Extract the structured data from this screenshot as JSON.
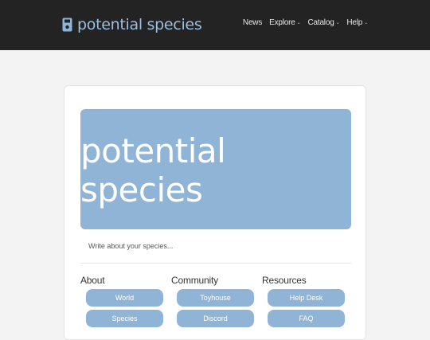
{
  "navbar": {
    "brand_icon": "save-disk-icon",
    "brand": "potential species",
    "links": [
      {
        "label": "News",
        "dropdown": false
      },
      {
        "label": "Explore",
        "dropdown": true
      },
      {
        "label": "Catalog",
        "dropdown": true
      },
      {
        "label": "Help",
        "dropdown": true
      }
    ],
    "caret": "⌄"
  },
  "card": {
    "banner_text": "potential species",
    "description": "Write about your species...",
    "columns": [
      {
        "heading": "About",
        "links": [
          "World",
          "Species"
        ]
      },
      {
        "heading": "Community",
        "links": [
          "Toyhouse",
          "Discord"
        ]
      },
      {
        "heading": "Resources",
        "links": [
          "Help Desk",
          "FAQ"
        ]
      }
    ]
  },
  "colors": {
    "navbar_bg": "#232323",
    "accent": "#8fb4d6",
    "page_bg": "#f3f3f3"
  }
}
